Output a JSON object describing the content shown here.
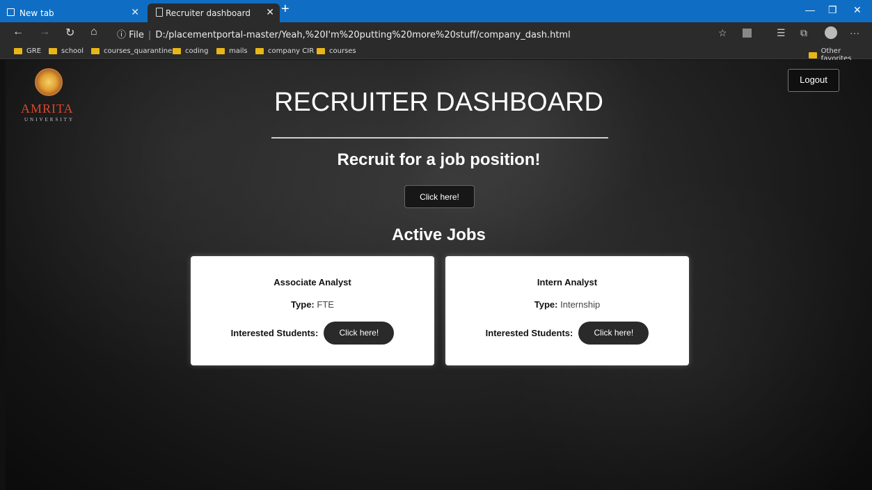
{
  "browser": {
    "tabs": [
      {
        "label": "New tab",
        "active": false
      },
      {
        "label": "Recruiter dashboard",
        "active": true
      }
    ],
    "address": {
      "info_label": "File",
      "url": "D:/placementportal-master/Yeah,%20I'm%20putting%20more%20stuff/company_dash.html"
    },
    "bookmarks": [
      "GRE",
      "school",
      "courses_quarantine",
      "coding",
      "mails",
      "company CIR",
      "courses"
    ],
    "other_favorites": "Other favorites"
  },
  "page": {
    "logo_text": "AMRITA",
    "logo_sub": "UNIVERSITY",
    "logout_label": "Logout",
    "title": "RECRUITER DASHBOARD",
    "recruit_heading": "Recruit for a job position!",
    "recruit_button": "Click here!",
    "active_jobs_heading": "Active Jobs",
    "jobs": [
      {
        "title": "Associate Analyst",
        "type_label": "Type:",
        "type": "FTE",
        "interested_label": "Interested Students:",
        "button": "Click here!"
      },
      {
        "title": "Intern Analyst",
        "type_label": "Type:",
        "type": "Internship",
        "interested_label": "Interested Students:",
        "button": "Click here!"
      }
    ]
  },
  "colors": {
    "titlebar": "#0f6ec4",
    "chrome": "#2b2b2b",
    "logo_red": "#d9482b",
    "button_dark": "#2a2a2a"
  }
}
